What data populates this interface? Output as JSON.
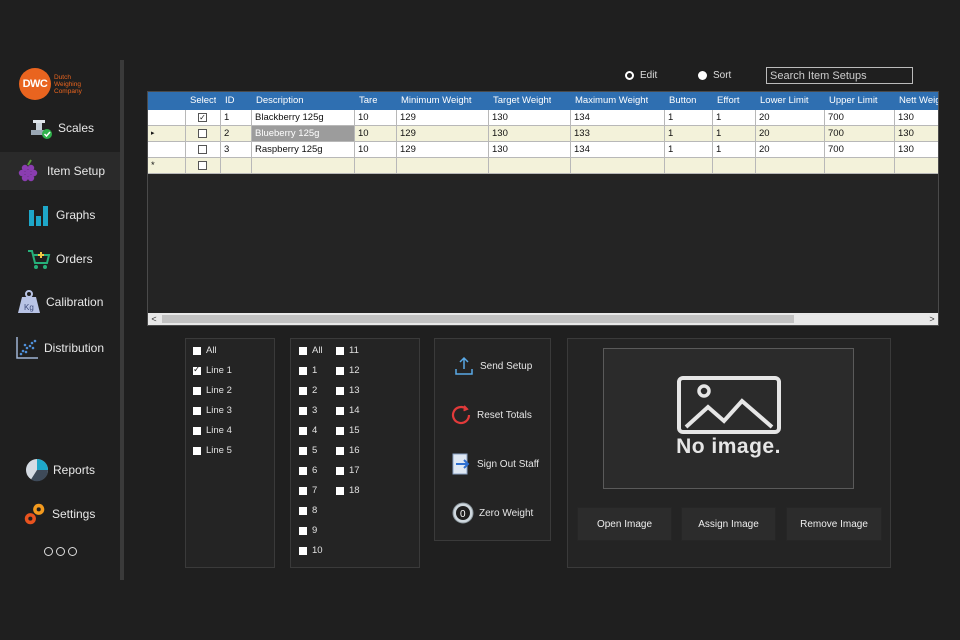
{
  "brand": {
    "logo_text": "DWC",
    "company_name": "Dutch Weighing Company",
    "color": "#e9641f"
  },
  "sidebar": {
    "items": [
      {
        "label": "Scales",
        "icon": "scales-icon"
      },
      {
        "label": "Item Setup",
        "icon": "grapes-icon"
      },
      {
        "label": "Graphs",
        "icon": "bar-chart-icon"
      },
      {
        "label": "Orders",
        "icon": "cart-icon"
      },
      {
        "label": "Calibration",
        "icon": "weight-kg-icon"
      },
      {
        "label": "Distribution",
        "icon": "scatter-icon"
      },
      {
        "label": "Reports",
        "icon": "pie-chart-icon"
      },
      {
        "label": "Settings",
        "icon": "gears-icon"
      }
    ],
    "active": "Item Setup"
  },
  "mode": {
    "edit_label": "Edit",
    "sort_label": "Sort",
    "selected": "Edit"
  },
  "search": {
    "placeholder": "Search Item Setups",
    "value": ""
  },
  "grid": {
    "header_color": "#2f6fb1",
    "columns": [
      "Select",
      "ID",
      "Description",
      "Tare",
      "Minimum Weight",
      "Target Weight",
      "Maximum Weight",
      "Button",
      "Effort",
      "Lower Limit",
      "Upper Limit",
      "Nett Weig"
    ],
    "rows": [
      {
        "selected": true,
        "id": "1",
        "description": "Blackberry 125g",
        "tare": "10",
        "min": "129",
        "target": "130",
        "max": "134",
        "button": "1",
        "effort": "1",
        "lower": "20",
        "upper": "700",
        "nett": "130"
      },
      {
        "selected": false,
        "id": "2",
        "description": "Blueberry 125g",
        "tare": "10",
        "min": "129",
        "target": "130",
        "max": "133",
        "button": "1",
        "effort": "1",
        "lower": "20",
        "upper": "700",
        "nett": "130"
      },
      {
        "selected": false,
        "id": "3",
        "description": "Raspberry 125g",
        "tare": "10",
        "min": "129",
        "target": "130",
        "max": "134",
        "button": "1",
        "effort": "1",
        "lower": "20",
        "upper": "700",
        "nett": "130"
      }
    ],
    "current_row_marker": "▸",
    "new_row_marker": "*"
  },
  "lines_panel": {
    "items": [
      {
        "label": "All",
        "checked": false
      },
      {
        "label": "Line 1",
        "checked": true
      },
      {
        "label": "Line 2",
        "checked": false
      },
      {
        "label": "Line 3",
        "checked": false
      },
      {
        "label": "Line 4",
        "checked": false
      },
      {
        "label": "Line 5",
        "checked": false
      }
    ]
  },
  "buttons_panel": {
    "col1": [
      "All",
      "1",
      "2",
      "3",
      "4",
      "5",
      "6",
      "7",
      "8",
      "9",
      "10"
    ],
    "col2": [
      "11",
      "12",
      "13",
      "14",
      "15",
      "16",
      "17",
      "18"
    ]
  },
  "actions": [
    {
      "label": "Send Setup",
      "icon": "upload-icon"
    },
    {
      "label": "Reset Totals",
      "icon": "reset-icon"
    },
    {
      "label": "Sign Out Staff",
      "icon": "sign-out-icon"
    },
    {
      "label": "Zero Weight",
      "icon": "zero-icon"
    }
  ],
  "image_panel": {
    "placeholder_text": "No image.",
    "open_label": "Open Image",
    "assign_label": "Assign Image",
    "remove_label": "Remove Image"
  }
}
